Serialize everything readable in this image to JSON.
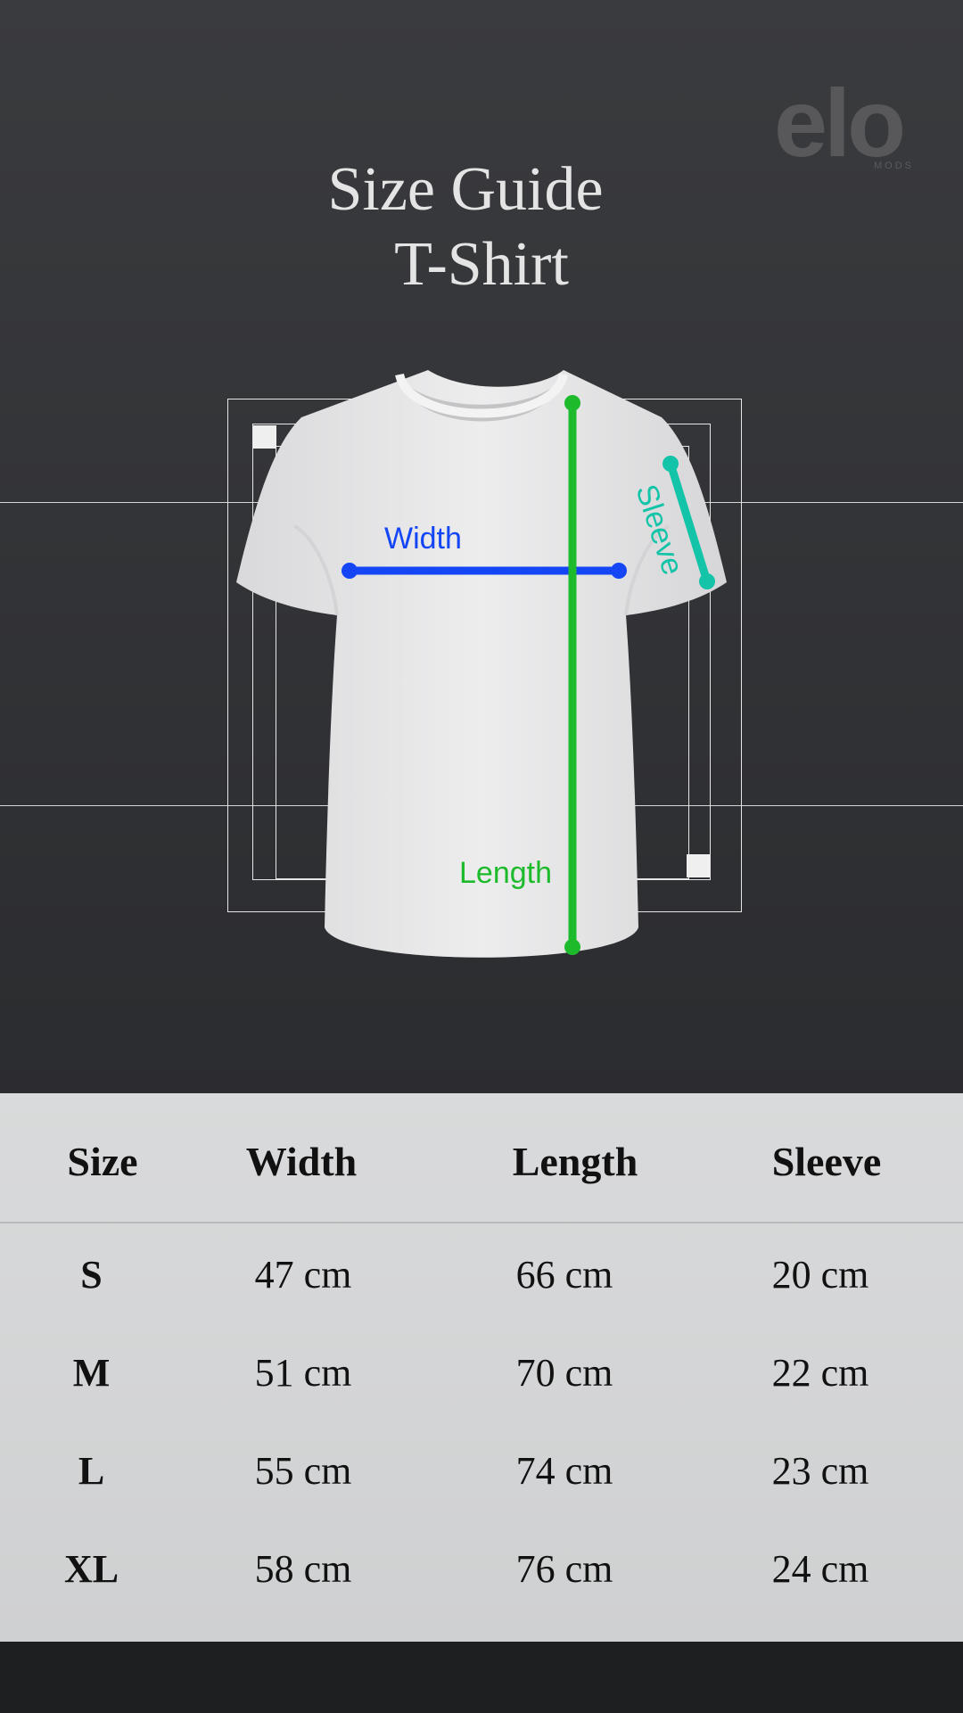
{
  "brand": {
    "logo_text": "elo",
    "logo_subtext": "MODS"
  },
  "title": {
    "line1": "Size Guide",
    "line2": "T-Shirt"
  },
  "diagram": {
    "width_label": "Width",
    "length_label": "Length",
    "sleeve_label": "Sleeve",
    "colors": {
      "width": "#1446f5",
      "length": "#1dbb2c",
      "sleeve": "#14c4a8",
      "shirt": "#e9e9ea"
    }
  },
  "table": {
    "headers": [
      "Size",
      "Width",
      "Length",
      "Sleeve"
    ],
    "rows": [
      {
        "size": "S",
        "width": "47 cm",
        "length": "66 cm",
        "sleeve": "20 cm"
      },
      {
        "size": "M",
        "width": "51 cm",
        "length": "70 cm",
        "sleeve": "22 cm"
      },
      {
        "size": "L",
        "width": "55 cm",
        "length": "74 cm",
        "sleeve": "23 cm"
      },
      {
        "size": "XL",
        "width": "58 cm",
        "length": "76 cm",
        "sleeve": "24 cm"
      }
    ]
  }
}
